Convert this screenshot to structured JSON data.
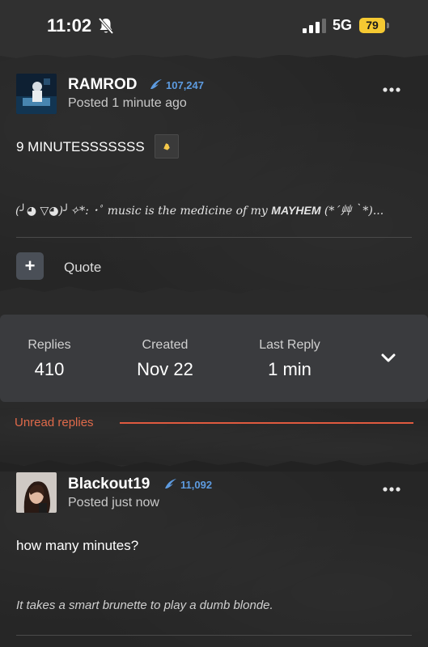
{
  "status_bar": {
    "time": "11:02",
    "network": "5G",
    "battery": "79"
  },
  "posts": [
    {
      "username": "RAMROD",
      "reputation": "107,247",
      "posted": "Posted 1 minute ago",
      "body": "9 MINUTESSSSSSS",
      "signature_prefix": "(╯◕ ▽◕)╯✧*: ･ﾟ ",
      "signature_text": "music is the medicine of my ",
      "signature_strong": "MAYHEM",
      "signature_suffix": " (*´艸｀*)..."
    },
    {
      "username": "Blackout19",
      "reputation": "11,092",
      "posted": "Posted just now",
      "body": "how many minutes?",
      "signature": "It takes a smart brunette to play a dumb blonde."
    }
  ],
  "quote_label": "Quote",
  "quote_button": "+",
  "stats": {
    "replies_label": "Replies",
    "replies_value": "410",
    "created_label": "Created",
    "created_value": "Nov 22",
    "last_reply_label": "Last Reply",
    "last_reply_value": "1 min"
  },
  "unread_label": "Unread replies",
  "colors": {
    "accent_red": "#e05a3f",
    "rep_blue": "#5d9be0",
    "battery_yellow": "#f5c932"
  }
}
